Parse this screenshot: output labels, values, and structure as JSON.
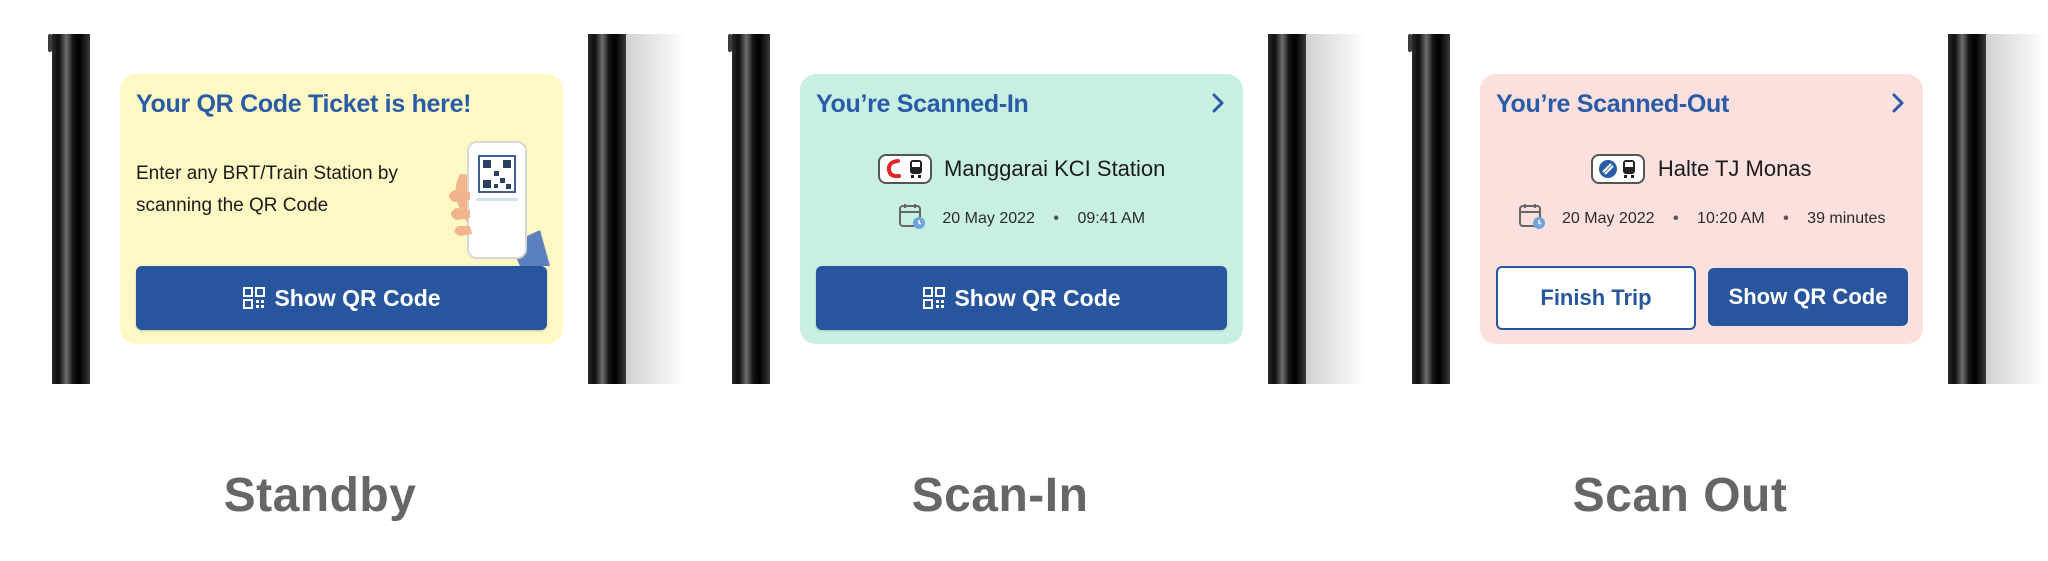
{
  "panels": [
    {
      "label": "Standby",
      "card": {
        "title": "Your QR Code Ticket is here!",
        "description": "Enter any BRT/Train Station by scanning the QR Code",
        "button_label": "Show QR Code",
        "background": "#fdf8c4"
      }
    },
    {
      "label": "Scan-In",
      "card": {
        "title": "You’re Scanned-In",
        "station": "Manggarai KCI Station",
        "date": "20 May 2022",
        "time": "09:41 AM",
        "button_label": "Show QR Code",
        "background": "#c8f0e2"
      }
    },
    {
      "label": "Scan Out",
      "card": {
        "title": "You’re Scanned-Out",
        "station": "Halte TJ Monas",
        "date": "20 May 2022",
        "time": "10:20 AM",
        "duration": "39 minutes",
        "secondary_button_label": "Finish Trip",
        "button_label": "Show QR Code",
        "background": "#fbe0de"
      }
    }
  ],
  "icons": [
    "qr-code-icon",
    "chevron-right-icon",
    "calendar-clock-icon",
    "train-logo-icon",
    "bus-logo-icon",
    "transjakarta-logo-icon"
  ],
  "colors": {
    "title": "#2a5ba7",
    "button": "#27569e",
    "label": "#666666"
  }
}
